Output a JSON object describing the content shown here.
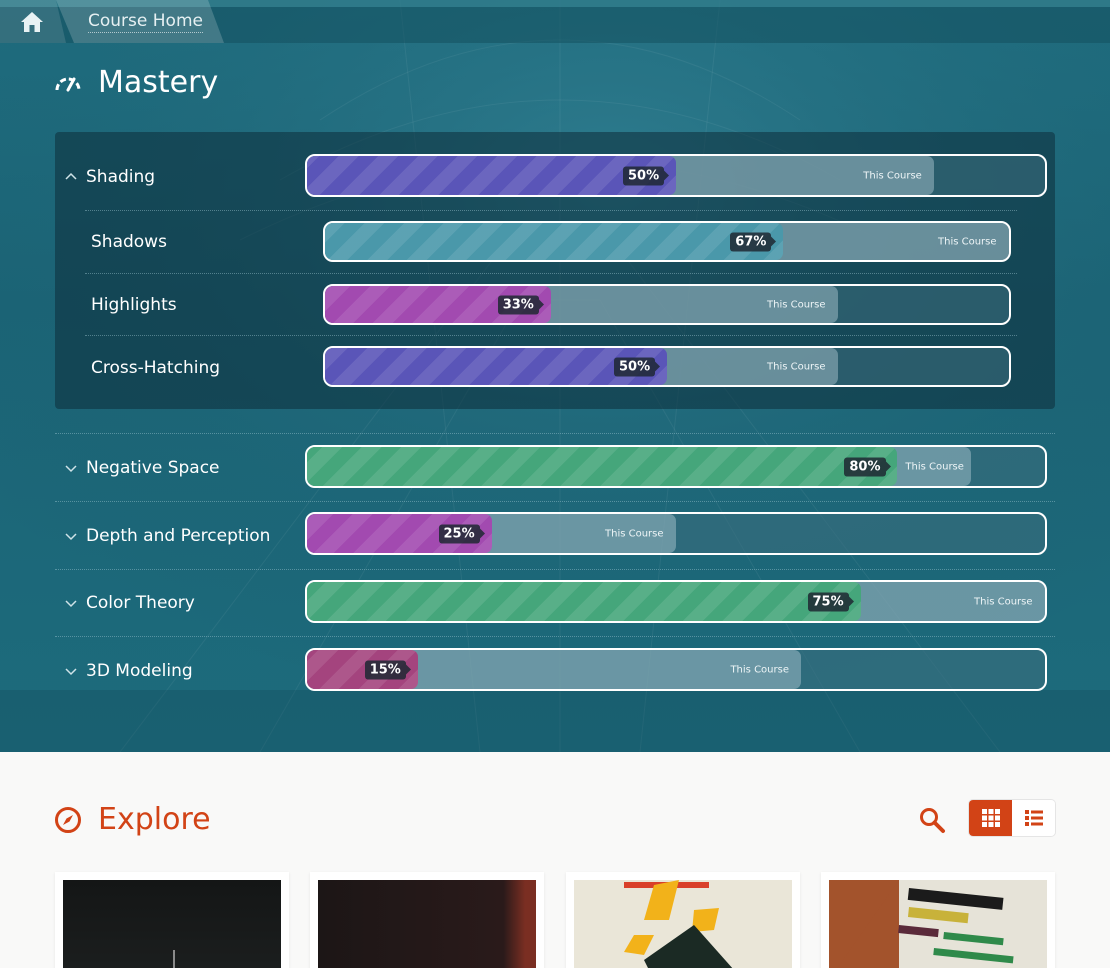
{
  "breadcrumb": {
    "home_icon": "home-icon",
    "current": "Course Home"
  },
  "mastery": {
    "title": "Mastery",
    "icon": "gauge-icon",
    "course_label": "This Course",
    "skills": [
      {
        "name": "Shading",
        "expanded": true,
        "percent": 50,
        "percent_label": "50%",
        "course_percent": 85,
        "color": "#5a55b8",
        "subskills": [
          {
            "name": "Shadows",
            "percent": 67,
            "percent_label": "67%",
            "course_percent": 100,
            "color": "#4a98aa"
          },
          {
            "name": "Highlights",
            "percent": 33,
            "percent_label": "33%",
            "course_percent": 75,
            "color": "#a24ab0"
          },
          {
            "name": "Cross-Hatching",
            "percent": 50,
            "percent_label": "50%",
            "course_percent": 75,
            "color": "#5a55b8"
          }
        ]
      },
      {
        "name": "Negative Space",
        "expanded": false,
        "percent": 80,
        "percent_label": "80%",
        "course_percent": 90,
        "color": "#45a67b"
      },
      {
        "name": "Depth and Perception",
        "expanded": false,
        "percent": 25,
        "percent_label": "25%",
        "course_percent": 50,
        "color": "#a24ab0"
      },
      {
        "name": "Color Theory",
        "expanded": false,
        "percent": 75,
        "percent_label": "75%",
        "course_percent": 100,
        "color": "#45a67b"
      },
      {
        "name": "3D Modeling",
        "expanded": false,
        "percent": 15,
        "percent_label": "15%",
        "course_percent": 67,
        "color": "#a4447e"
      }
    ]
  },
  "explore": {
    "title": "Explore",
    "icon": "compass-icon",
    "accent": "#d24316",
    "search_icon": "search-icon",
    "view_grid_icon": "grid-view-icon",
    "view_list_icon": "list-view-icon",
    "cards": [
      {
        "thumb": "dark-painting-thumbnail"
      },
      {
        "thumb": "dark-red-painting-thumbnail"
      },
      {
        "thumb": "suprematist-yellow-thumbnail"
      },
      {
        "thumb": "suprematist-bars-thumbnail"
      }
    ]
  }
}
